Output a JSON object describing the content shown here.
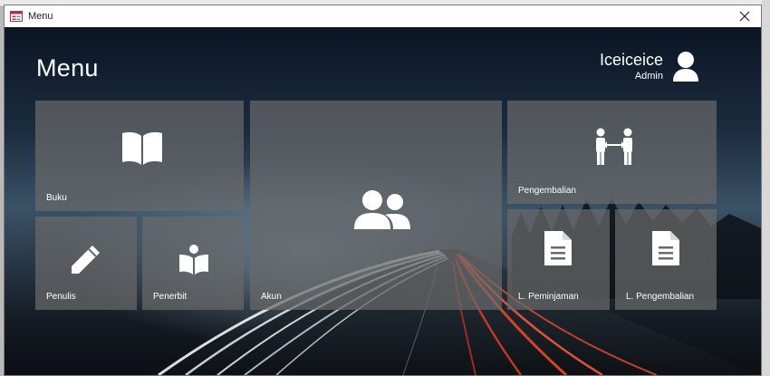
{
  "window": {
    "title": "Menu",
    "app_icon": "form-icon",
    "close_icon": "close-icon"
  },
  "header": {
    "title": "Menu"
  },
  "user": {
    "name": "Iceiceice",
    "role": "Admin",
    "icon": "user-icon"
  },
  "tiles": {
    "buku": {
      "label": "Buku",
      "icon": "book-open-icon"
    },
    "akun": {
      "label": "Akun",
      "icon": "users-icon"
    },
    "pengembalian": {
      "label": "Pengembalian",
      "icon": "exchange-people-icon"
    },
    "penulis": {
      "label": "Penulis",
      "icon": "pencil-icon"
    },
    "penerbit": {
      "label": "Penerbit",
      "icon": "reader-icon"
    },
    "l_peminjaman": {
      "label": "L. Peminjaman",
      "icon": "document-icon"
    },
    "l_pengembalian": {
      "label": "L. Pengembalian",
      "icon": "document-icon"
    }
  },
  "colors": {
    "tile": "#696969",
    "text": "#ffffff",
    "background_sky": "#1b2c40",
    "light_trail_red": "#e0452c",
    "light_trail_white": "#f2f2f2"
  }
}
